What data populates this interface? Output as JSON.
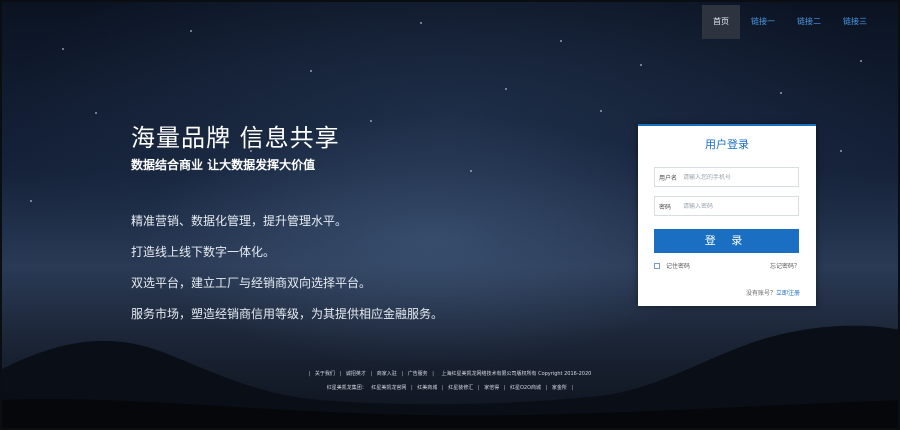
{
  "nav": {
    "items": [
      "首页",
      "链接一",
      "链接二",
      "链接三"
    ],
    "active_index": 0
  },
  "hero": {
    "title": "海量品牌 信息共享",
    "subtitle": "数据结合商业 让大数据发挥大价值"
  },
  "features": [
    "精准营销、数据化管理，提升管理水平。",
    "打造线上线下数字一体化。",
    "双选平台，建立工厂与经销商双向选择平台。",
    "服务市场，塑造经销商信用等级，为其提供相应金融服务。"
  ],
  "login": {
    "title": "用户登录",
    "username_label": "用户名",
    "username_placeholder": "请输入您的手机号",
    "password_label": "密码",
    "password_placeholder": "请输入密码",
    "submit_label": "登 录",
    "remember_label": "记住密码",
    "remember_checked": false,
    "forgot_label": "忘记密码？",
    "register_prompt": "没有账号？",
    "register_link": "立即注册"
  },
  "footer": {
    "row1_links": [
      "关于我们",
      "诚招英才",
      "商家入驻",
      "广告服务"
    ],
    "copyright": "上海红星美凯龙网络技术有限公司版权所有   Copyright 2016-2020",
    "row2_prefix": "红星美凯龙集团：",
    "row2_links": [
      "红星美凯龙官网",
      "红美商城",
      "红星装修汇",
      "家倍得",
      "红星O2O商城",
      "家金所"
    ]
  },
  "colors": {
    "accent": "#1a6fc3",
    "nav_link": "#4d9be6",
    "nav_active_bg": "#2d3440"
  }
}
